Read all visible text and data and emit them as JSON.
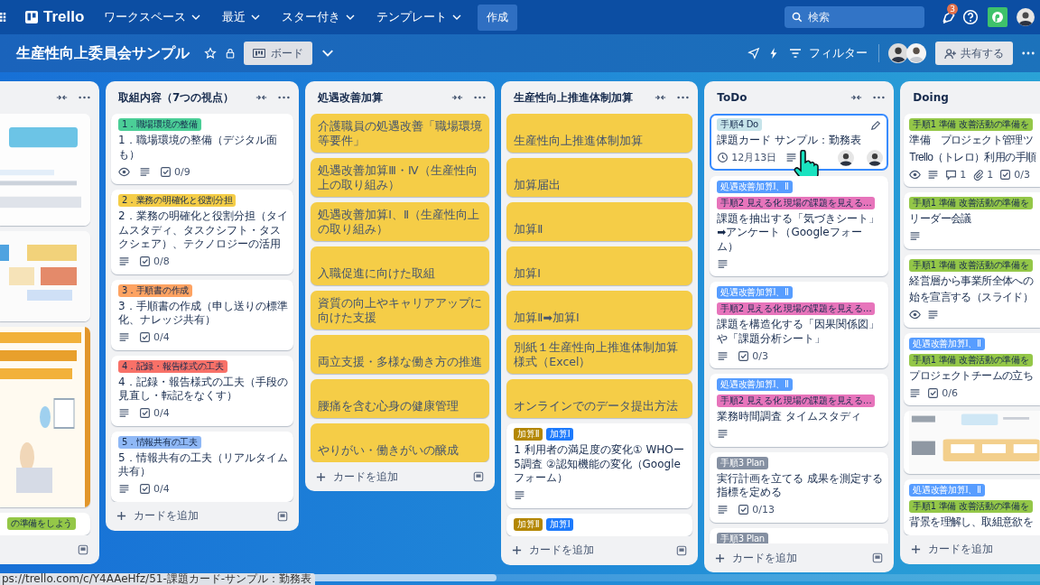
{
  "topbar": {
    "logo": "Trello",
    "menus": [
      {
        "label": "ワークスペース"
      },
      {
        "label": "最近"
      },
      {
        "label": "スター付き"
      },
      {
        "label": "テンプレート"
      }
    ],
    "create": "作成",
    "search": {
      "placeholder": "検索"
    },
    "notification_count": "3"
  },
  "board_header": {
    "title": "生産性向上委員会サンプル",
    "starred": false,
    "view": "ボード",
    "filter": "フィルター",
    "share": "共有する"
  },
  "lists": [
    {
      "kind": "clipped_left",
      "cards": [
        {
          "kind": "picture"
        },
        {
          "kind": "picture"
        },
        {
          "kind": "picture"
        },
        {
          "kind": "plain",
          "labels": [
            {
              "text": "の準備をしよう",
              "color": "#94c748"
            }
          ]
        }
      ]
    },
    {
      "kind": "full",
      "title": "取組内容（7つの視点）",
      "add": "カードを追加",
      "cards": [
        {
          "kind": "plain",
          "labels": [
            {
              "text": "1．職場環境の整備",
              "color": "#4bce97"
            }
          ],
          "title": "1．職場環境の整備（デジタル面も）",
          "badges": [
            {
              "kind": "watch"
            },
            {
              "kind": "description"
            },
            {
              "kind": "checklist",
              "text": "0/9"
            }
          ]
        },
        {
          "kind": "plain",
          "labels": [
            {
              "text": "2．業務の明確化と役割分担",
              "color": "#f5cd47"
            }
          ],
          "title": "2．業務の明確化と役割分担（タイムスタディ、タスクシフト・タスクシェア）、テクノロジーの活用",
          "badges": [
            {
              "kind": "description"
            },
            {
              "kind": "checklist",
              "text": "0/8"
            }
          ]
        },
        {
          "kind": "plain",
          "labels": [
            {
              "text": "3．手順書の作成",
              "color": "#fea362"
            }
          ],
          "title": "3．手順書の作成（申し送りの標準化、ナレッジ共有）",
          "badges": [
            {
              "kind": "description"
            },
            {
              "kind": "checklist",
              "text": "0/4"
            }
          ]
        },
        {
          "kind": "plain",
          "labels": [
            {
              "text": "4．記録・報告様式の工夫",
              "color": "#f87168"
            }
          ],
          "title": "4．記録・報告様式の工夫（手段の見直し・転記をなくす）",
          "badges": [
            {
              "kind": "description"
            },
            {
              "kind": "checklist",
              "text": "0/4"
            }
          ]
        },
        {
          "kind": "plain",
          "labels": [
            {
              "text": "5．情報共有の工夫",
              "color": "#8fb8f6"
            }
          ],
          "title": "5．情報共有の工夫（リアルタイム共有）",
          "badges": [
            {
              "kind": "description"
            },
            {
              "kind": "checklist",
              "text": "0/4"
            }
          ]
        }
      ]
    },
    {
      "kind": "full",
      "title": "処遇改善加算",
      "add": "カードを追加",
      "cards": [
        {
          "kind": "filled",
          "color": "#f5cd47",
          "title": "介護職員の処遇改善「職場環境等要件」"
        },
        {
          "kind": "filled",
          "color": "#f5cd47",
          "title": "処遇改善加算Ⅲ・Ⅳ（生産性向上の取り組み）"
        },
        {
          "kind": "filled",
          "color": "#f5cd47",
          "title": "処遇改善加算Ⅰ、Ⅱ（生産性向上の取り組み）"
        },
        {
          "kind": "filled",
          "color": "#f5cd47",
          "title": "入職促進に向けた取組"
        },
        {
          "kind": "filled",
          "color": "#f5cd47",
          "title": "資質の向上やキャリアアップに向けた支援"
        },
        {
          "kind": "filled",
          "color": "#f5cd47",
          "title": "両立支援・多様な働き方の推進"
        },
        {
          "kind": "filled",
          "color": "#f5cd47",
          "title": "腰痛を含む心身の健康管理"
        },
        {
          "kind": "filled",
          "color": "#f5cd47",
          "title": "やりがい・働きがいの醸成"
        }
      ]
    },
    {
      "kind": "full",
      "title": "生産性向上推進体制加算",
      "add": "カードを追加",
      "cards": [
        {
          "kind": "filled",
          "color": "#f5cd47",
          "title": "生産性向上推進体制加算"
        },
        {
          "kind": "filled",
          "color": "#f5cd47",
          "title": "加算届出"
        },
        {
          "kind": "filled",
          "color": "#f5cd47",
          "title": "加算Ⅱ"
        },
        {
          "kind": "filled",
          "color": "#f5cd47",
          "title": "加算Ⅰ"
        },
        {
          "kind": "filled",
          "color": "#f5cd47",
          "title": "加算Ⅱ➡加算Ⅰ"
        },
        {
          "kind": "filled",
          "color": "#f5cd47",
          "title": "別紙１生産性向上推進体制加算様式（Excel）"
        },
        {
          "kind": "filled",
          "color": "#f5cd47",
          "title": "オンラインでのデータ提出方法"
        },
        {
          "kind": "plain",
          "labels": [
            {
              "text": "加算Ⅱ",
              "color": "#b38600"
            },
            {
              "text": "加算Ⅰ",
              "color": "#1d7afc"
            }
          ],
          "title": "1 利用者の満足度の変化① WHOー5調査 ②認知機能の変化（Googleフォーム）",
          "badges": [
            {
              "kind": "description"
            }
          ]
        },
        {
          "kind": "plain",
          "labels": [
            {
              "text": "加算Ⅱ",
              "color": "#b38600"
            },
            {
              "text": "加算Ⅰ",
              "color": "#1d7afc"
            }
          ]
        }
      ]
    },
    {
      "kind": "full",
      "title": "ToDo",
      "add": "カードを追加",
      "cards": [
        {
          "kind": "plain",
          "focused": true,
          "labels": [
            {
              "text": "手順4 Do",
              "color": "#c6e4ea"
            }
          ],
          "title": "課題カード サンプル：勤務表",
          "badges": [
            {
              "kind": "due",
              "text": "12月13日"
            },
            {
              "kind": "description"
            },
            {
              "kind": "member"
            },
            {
              "kind": "member"
            }
          ]
        },
        {
          "kind": "plain",
          "focused": false,
          "labels": [
            {
              "text": "処遇改善加算Ⅰ、Ⅱ",
              "color": "#579dff"
            },
            {
              "text": "手順2 見える化 現場の課題を見える…",
              "color": "#e774bb"
            }
          ],
          "title": "課題を抽出する「気づきシート」➡アンケート（Googleフォーム）",
          "badges": [
            {
              "kind": "description"
            }
          ]
        },
        {
          "kind": "plain",
          "focused": false,
          "labels": [
            {
              "text": "処遇改善加算Ⅰ、Ⅱ",
              "color": "#579dff"
            },
            {
              "text": "手順2 見える化 現場の課題を見える…",
              "color": "#e774bb"
            }
          ],
          "title": "課題を構造化する「因果関係図」や「課題分析シート」",
          "badges": [
            {
              "kind": "description"
            },
            {
              "kind": "checklist",
              "text": "0/3"
            }
          ]
        },
        {
          "kind": "plain",
          "focused": false,
          "labels": [
            {
              "text": "処遇改善加算Ⅰ、Ⅱ",
              "color": "#579dff"
            },
            {
              "text": "手順2 見える化 現場の課題を見える…",
              "color": "#e774bb"
            }
          ],
          "title": "業務時間調査 タイムスタディ",
          "badges": [
            {
              "kind": "description"
            }
          ]
        },
        {
          "kind": "plain",
          "focused": false,
          "labels": [
            {
              "text": "手順3 Plan",
              "color": "#8590a2"
            }
          ],
          "title": "実行計画を立てる 成果を測定する指標を定める",
          "badges": [
            {
              "kind": "description"
            },
            {
              "kind": "checklist",
              "text": "0/13"
            }
          ]
        },
        {
          "kind": "plain",
          "focused": false,
          "labels": [
            {
              "text": "手順3 Plan",
              "color": "#8590a2"
            }
          ]
        }
      ]
    },
    {
      "kind": "clipped_right",
      "title": "Doing",
      "add": "カードを追加",
      "cards": [
        {
          "kind": "plain",
          "labels": [
            {
              "text": "手順1 準備 改善活動の準備を",
              "color": "#94c748"
            }
          ],
          "title_lines": [
            "準備　プロジェクト管理ツ",
            "Trello（トレロ）利用の手順"
          ],
          "badges": [
            {
              "kind": "watch"
            },
            {
              "kind": "description"
            },
            {
              "kind": "comments",
              "text": "1"
            },
            {
              "kind": "attachments",
              "text": "1"
            },
            {
              "kind": "checklist",
              "text": "0/3"
            }
          ]
        },
        {
          "kind": "plain",
          "labels": [
            {
              "text": "手順1 準備 改善活動の準備を",
              "color": "#94c748"
            }
          ],
          "title_lines": [
            "リーダー会議"
          ],
          "badges": [
            {
              "kind": "description"
            }
          ]
        },
        {
          "kind": "plain",
          "labels": [
            {
              "text": "手順1 準備 改善活動の準備を",
              "color": "#94c748"
            }
          ],
          "title_lines": [
            "経営層から事業所全体への",
            "始を宣言する（スライド）"
          ],
          "badges": [
            {
              "kind": "watch"
            },
            {
              "kind": "description"
            }
          ]
        },
        {
          "kind": "plain",
          "labels": [
            {
              "text": "処遇改善加算Ⅰ、Ⅱ",
              "color": "#579dff"
            },
            {
              "text": "手順1 準備 改善活動の準備を",
              "color": "#94c748"
            }
          ],
          "title_lines": [
            "プロジェクトチームの立ち"
          ],
          "badges": [
            {
              "kind": "description"
            },
            {
              "kind": "checklist",
              "text": "0/6"
            }
          ]
        },
        {
          "kind": "picture"
        },
        {
          "kind": "plain",
          "labels": [
            {
              "text": "処遇改善加算Ⅰ、Ⅱ",
              "color": "#579dff"
            },
            {
              "text": "手順1 準備 改善活動の準備を",
              "color": "#94c748"
            }
          ],
          "title_lines": [
            "背景を理解し、取組意欲を"
          ]
        }
      ]
    }
  ],
  "status_url": "ps://trello.com/c/Y4AAeHfz/51-課題カード-サンプル：勤務表"
}
